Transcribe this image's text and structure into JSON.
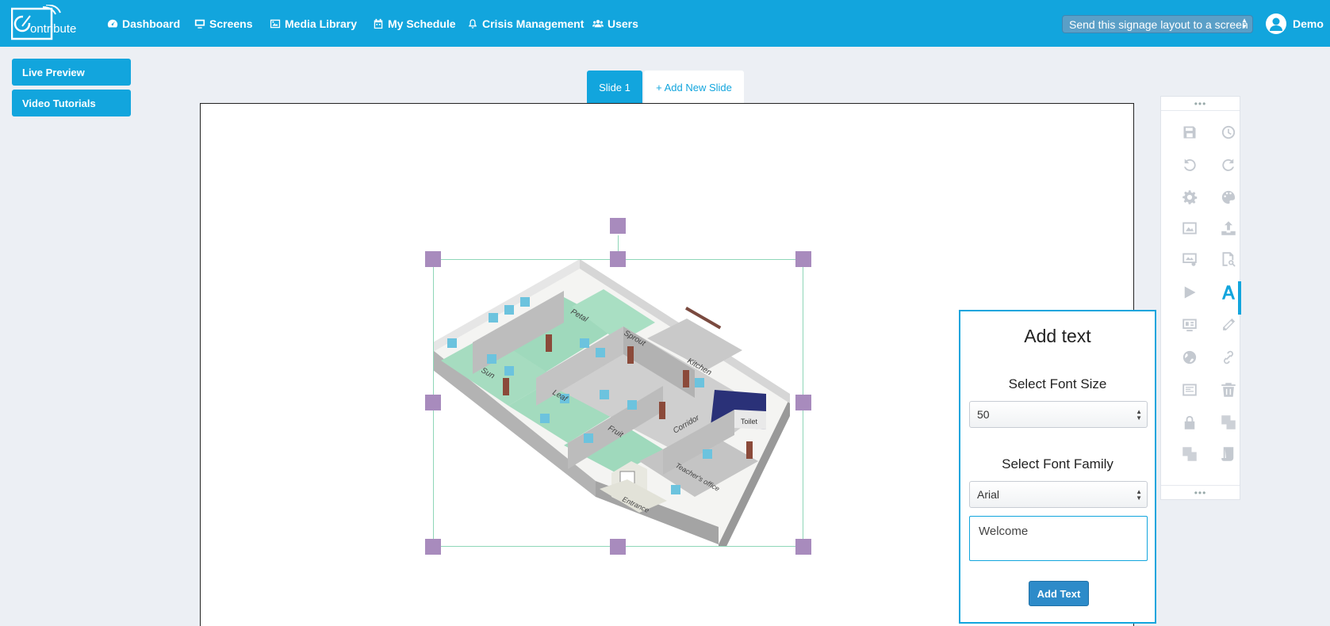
{
  "navbar": {
    "logo_text": "ontribute",
    "items": [
      {
        "label": "Dashboard",
        "icon": "dashboard-icon"
      },
      {
        "label": "Screens",
        "icon": "monitor-icon"
      },
      {
        "label": "Media Library",
        "icon": "image-icon"
      },
      {
        "label": "My Schedule",
        "icon": "calendar-icon"
      },
      {
        "label": "Crisis Management",
        "icon": "bell-icon"
      },
      {
        "label": "Users",
        "icon": "users-icon"
      }
    ],
    "send_select": "Send this signage layout to a screen",
    "user_name": "Demo"
  },
  "sidebar": {
    "live_preview": "Live Preview",
    "video_tutorials": "Video Tutorials"
  },
  "tabs": {
    "active": "Slide 1",
    "add": "+ Add New Slide"
  },
  "floorplan": {
    "rooms": [
      "Petal",
      "Sprout",
      "Kitchen",
      "Sun",
      "Leaf",
      "Fruit",
      "Corridor",
      "Toilet",
      "Teacher's office",
      "Entrance"
    ]
  },
  "toolbar": {
    "grip": "•••",
    "icons": [
      "save-icon",
      "history-icon",
      "undo-icon",
      "redo-icon",
      "settings-icon",
      "palette-icon",
      "image-icon",
      "upload-icon",
      "image-settings-icon",
      "zoom-icon",
      "play-icon",
      "text-icon",
      "widget-icon",
      "pencil-icon",
      "globe-icon",
      "link-icon",
      "layout-icon",
      "trash-icon",
      "lock-icon",
      "layers-forward-icon",
      "layers-back-icon",
      "script-icon"
    ],
    "active": "text-icon",
    "accent": "#12a5dd"
  },
  "panel": {
    "title": "Add text",
    "font_size_label": "Select Font Size",
    "font_size_value": "50",
    "font_family_label": "Select Font Family",
    "font_family_value": "Arial",
    "text_value": "Welcome",
    "button": "Add Text"
  },
  "colors": {
    "brand": "#12a5dd",
    "handle": "#a88bbd",
    "selection": "#8fd6b8"
  }
}
